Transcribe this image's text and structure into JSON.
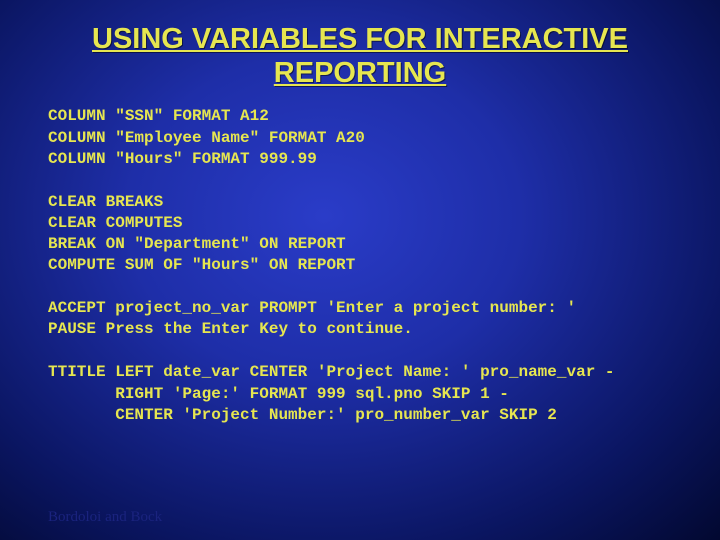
{
  "title": "USING VARIABLES FOR INTERACTIVE REPORTING",
  "block1": "COLUMN \"SSN\" FORMAT A12\nCOLUMN \"Employee Name\" FORMAT A20\nCOLUMN \"Hours\" FORMAT 999.99",
  "block2": "CLEAR BREAKS\nCLEAR COMPUTES\nBREAK ON \"Department\" ON REPORT\nCOMPUTE SUM OF \"Hours\" ON REPORT",
  "block3": "ACCEPT project_no_var PROMPT 'Enter a project number: '\nPAUSE Press the Enter Key to continue.",
  "block4": "TTITLE LEFT date_var CENTER 'Project Name: ' pro_name_var -\n       RIGHT 'Page:' FORMAT 999 sql.pno SKIP 1 -\n       CENTER 'Project Number:' pro_number_var SKIP 2",
  "footer": "Bordoloi and Bock"
}
